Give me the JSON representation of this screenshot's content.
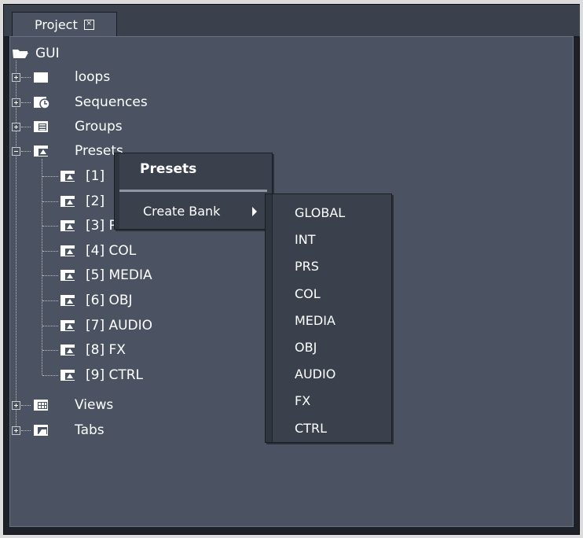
{
  "tab": {
    "label": "Project"
  },
  "tree": {
    "root": "GUI",
    "items": [
      {
        "label": "loops"
      },
      {
        "label": "Sequences"
      },
      {
        "label": "Groups"
      },
      {
        "label": "Presets"
      },
      {
        "label": "Views"
      },
      {
        "label": "Tabs"
      }
    ],
    "presets_children": [
      "[1]",
      "[2]",
      "[3] PRS",
      "[4] COL",
      "[5] MEDIA",
      "[6] OBJ",
      "[7] AUDIO",
      "[8] FX",
      "[9] CTRL"
    ]
  },
  "context_menu": {
    "title": "Presets",
    "item": "Create Bank",
    "submenu": [
      "GLOBAL",
      "INT",
      "PRS",
      "COL",
      "MEDIA",
      "OBJ",
      "AUDIO",
      "FX",
      "CTRL"
    ]
  },
  "colors": {
    "background": "#4b5363",
    "menu": "#3a414c",
    "text": "#ffffff"
  }
}
